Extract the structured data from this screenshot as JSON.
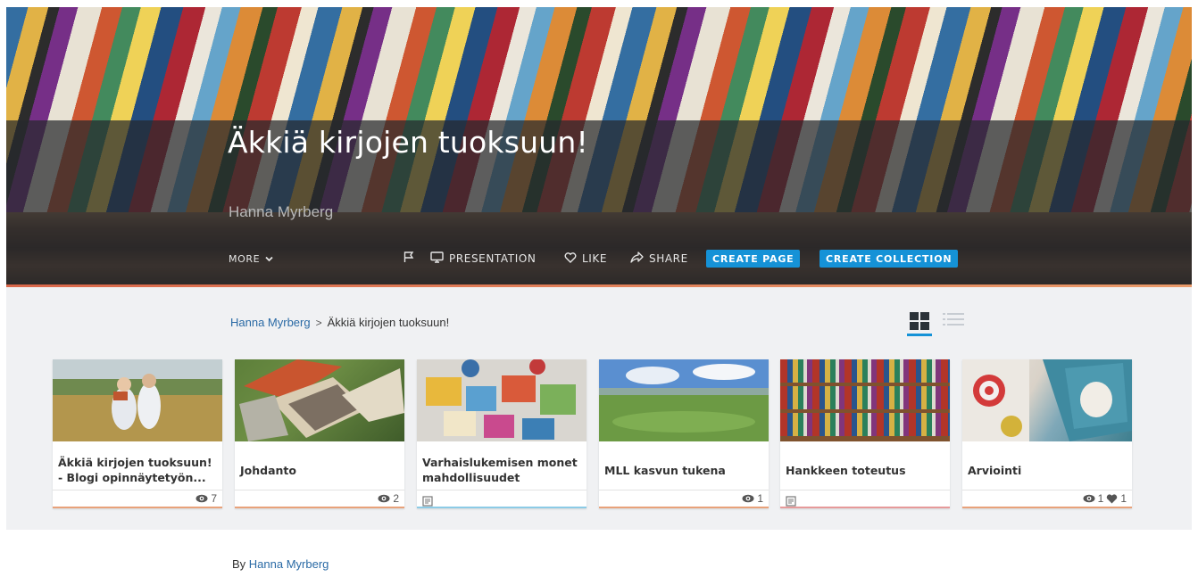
{
  "hero": {
    "title": "Äkkiä kirjojen tuoksuun!",
    "owner": "Hanna Myrberg",
    "banner_image": "bookshelf-banner"
  },
  "toolbar": {
    "more_label": "MORE",
    "presentation_label": "PRESENTATION",
    "like_label": "LIKE",
    "share_label": "SHARE",
    "create_page_label": "CREATE PAGE",
    "create_collection_label": "CREATE COLLECTION"
  },
  "breadcrumb": {
    "root": "Hanna Myrberg",
    "separator": ">",
    "current": "Äkkiä kirjojen tuoksuun!"
  },
  "view": {
    "active": "grid"
  },
  "cards": [
    {
      "title": "Äkkiä kirjojen tuoksuun! - Blogi opinnäytetyön...",
      "views": "7",
      "likes": "",
      "doc_icon": false,
      "accent": "#e8a27a",
      "thumb": "children-in-field"
    },
    {
      "title": "Johdanto",
      "views": "2",
      "likes": "",
      "doc_icon": false,
      "accent": "#e8a27a",
      "thumb": "books-on-grass"
    },
    {
      "title": "Varhaislukemisen monet mahdollisuudet",
      "views": "",
      "likes": "",
      "doc_icon": true,
      "accent": "#8ccbe6",
      "thumb": "picture-books-on-floor"
    },
    {
      "title": "MLL kasvun tukena",
      "views": "1",
      "likes": "",
      "doc_icon": false,
      "accent": "#e8a27a",
      "thumb": "green-meadow"
    },
    {
      "title": "Hankkeen toteutus",
      "views": "",
      "likes": "",
      "doc_icon": true,
      "accent": "#e69a9a",
      "thumb": "library-shelves"
    },
    {
      "title": "Arviointi",
      "views": "1",
      "likes": "1",
      "doc_icon": false,
      "accent": "#e8a27a",
      "thumb": "books-and-toy"
    }
  ],
  "footer": {
    "by_label": "By",
    "author": "Hanna Myrberg"
  },
  "colors": {
    "accent": "#1592d7",
    "link": "#2a6aa5",
    "hero_line": "#d9674a"
  }
}
